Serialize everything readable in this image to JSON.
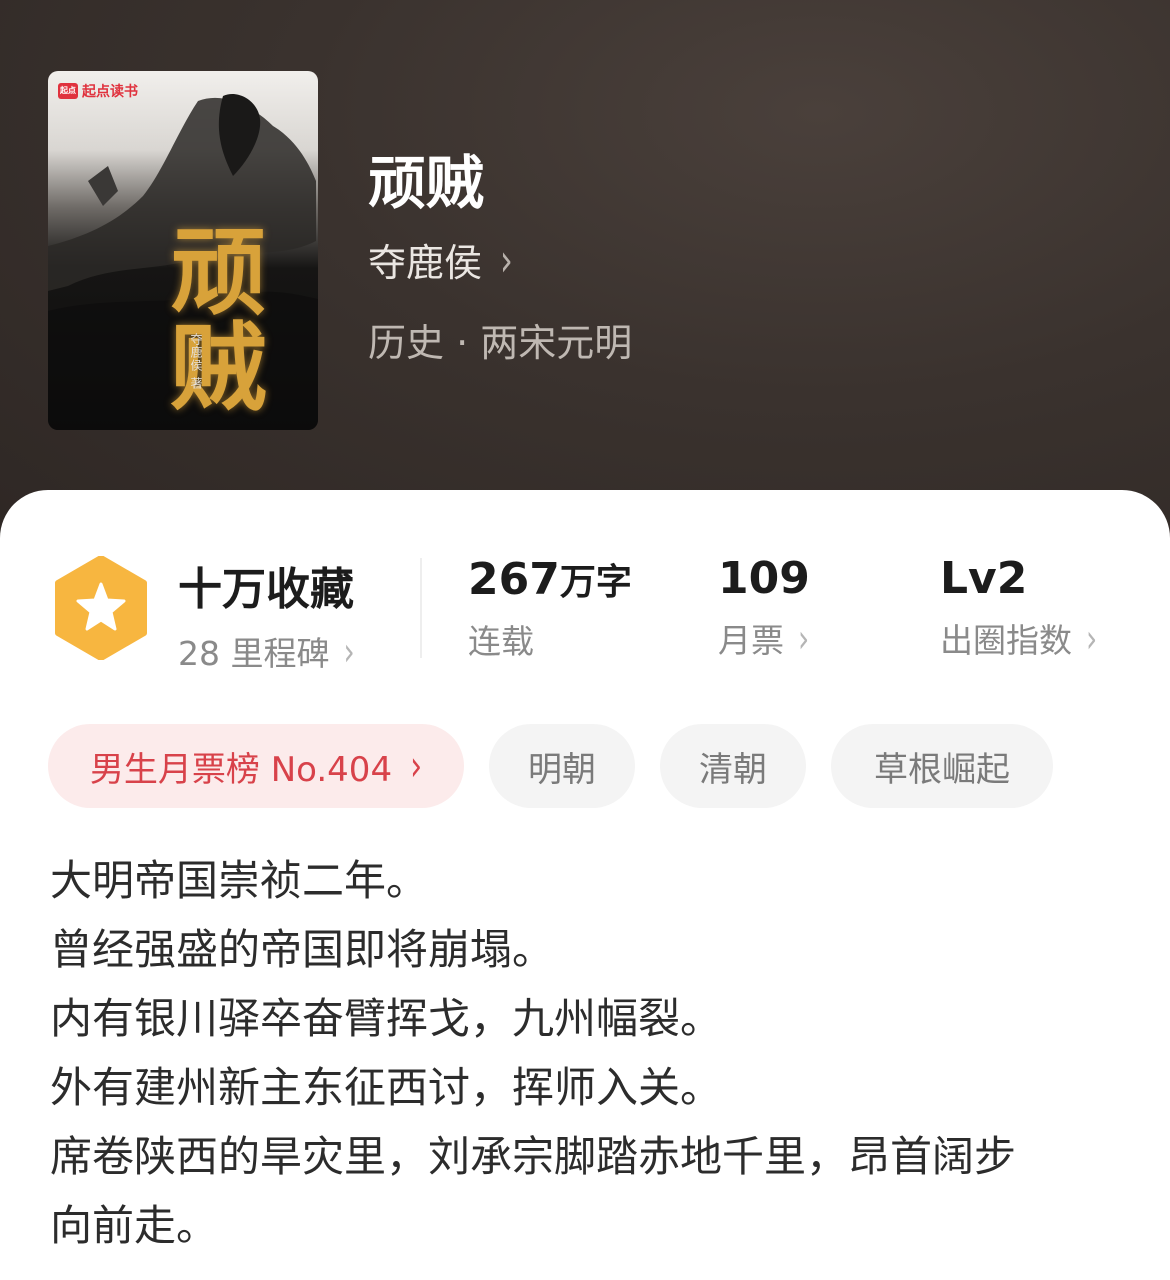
{
  "book": {
    "cover": {
      "brand": "起点读书",
      "brand_logo": "起点",
      "title": "顽贼",
      "author": "夺鹿侯 著"
    },
    "title": "顽贼",
    "author": "夺鹿侯",
    "genre": "历史 · 两宋元明"
  },
  "stats": {
    "favorites": {
      "value": "十万收藏",
      "label": "28 里程碑"
    },
    "words": {
      "value": "267",
      "unit": "万字",
      "label": "连载"
    },
    "tickets": {
      "value": "109",
      "label": "月票"
    },
    "level": {
      "value": "Lv2",
      "label": "出圈指数"
    }
  },
  "tags": {
    "rank": "男生月票榜 No.404",
    "items": [
      "明朝",
      "清朝",
      "草根崛起"
    ]
  },
  "description": [
    "大明帝国崇祯二年。",
    "曾经强盛的帝国即将崩塌。",
    "内有银川驿卒奋臂挥戈，九州幅裂。",
    "外有建州新主东征西讨，挥师入关。",
    "席卷陕西的旱灾里，刘承宗脚踏赤地千里，昂首阔步",
    "向前走。"
  ],
  "colors": {
    "hero_bg": "#3a322e",
    "badge": "#f7b640",
    "rank_text": "#d8424a",
    "rank_bg": "#fcebeb"
  }
}
